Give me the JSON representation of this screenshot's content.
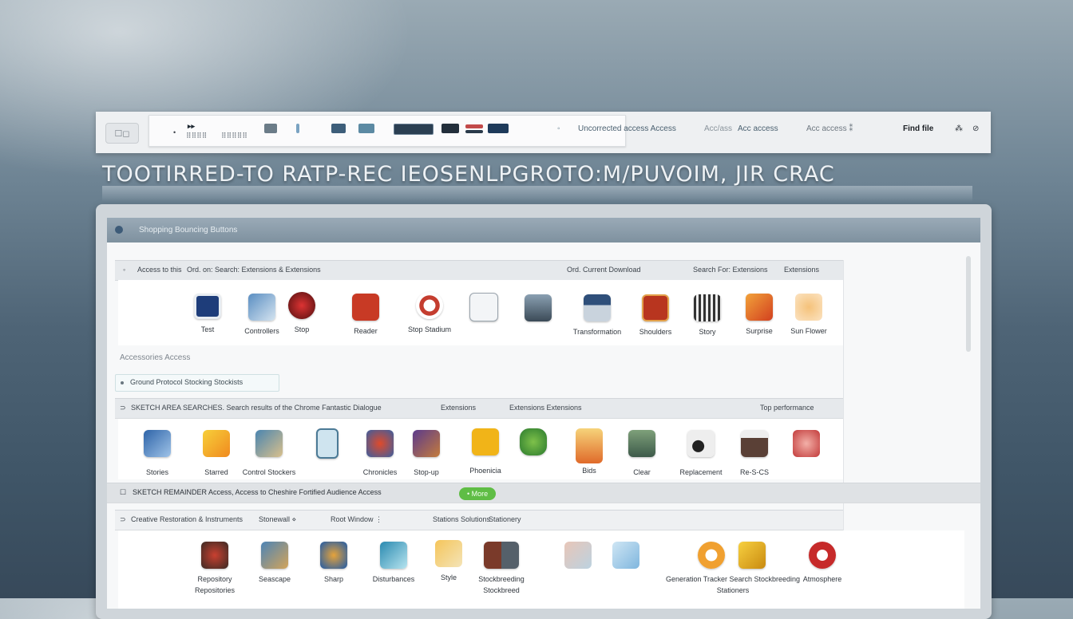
{
  "toolbar": {
    "left_label": "☐◻",
    "items": [
      "▸▸",
      "•",
      "⠿⠿",
      "Ƀ⠿⠿",
      "⠿ ◌ ⠿⠿",
      "◦"
    ],
    "right_items": [
      "Uncorrected access Access",
      "Acc/ass",
      "Acc access",
      "Acc access ⁑"
    ],
    "right_strong": "Find file",
    "settings_glyph": "⁂",
    "close_glyph": "⊘"
  },
  "headline": "TOOTIRRED-TO RATP-REC IEOSENLPGROTO:M/PUVOIM, JIR CRAC",
  "window": {
    "title": "Shopping Bouncing Buttons",
    "section1": {
      "left": "Access to this",
      "mid": "Ord. on: Search: Extensions & Extensions",
      "right1": "Ord. Current Download",
      "right2": "Search For: Extensions",
      "right3": "Extensions"
    },
    "row1": [
      {
        "label": ""
      },
      {
        "label": "Test"
      },
      {
        "label": "Controllers"
      },
      {
        "label": "Stop"
      },
      {
        "label": "Reader"
      },
      {
        "label": "Stop Stadium"
      },
      {
        "label": ""
      },
      {
        "label": ""
      },
      {
        "label": "Transformation"
      },
      {
        "label": "Shoulders"
      },
      {
        "label": "Story"
      },
      {
        "label": "Surprise"
      },
      {
        "label": "Sun Flower"
      }
    ],
    "sub_text": "Accessories Access",
    "search_text": "Ground Protocol Stocking Stockists",
    "section2": {
      "left": "SKETCH AREA SEARCHES. Search results of the Chrome Fantastic Dialogue",
      "mid": "Extensions",
      "mid2": "Extensions Extensions",
      "right": "Top performance"
    },
    "row2": [
      {
        "label": "Stories"
      },
      {
        "label": "Starred"
      },
      {
        "label": "Control Stockers"
      },
      {
        "label": ""
      },
      {
        "label": "Chronicles"
      },
      {
        "label": "Stop-up"
      },
      {
        "label": "Phoenicia"
      },
      {
        "label": ""
      },
      {
        "label": "Bids"
      },
      {
        "label": "Clear"
      },
      {
        "label": "Replacement"
      },
      {
        "label": "Re-S-CS"
      },
      {
        "label": ""
      }
    ],
    "section3": {
      "left": "SKETCH REMAINDER Access, Access to Cheshire Fortified Audience Access",
      "pill": "• More"
    },
    "section4": {
      "left": "Creative Restoration & Instruments",
      "mid": "Stonewall ⋄",
      "mid2": "Root Window ⋮",
      "right1": "Stations Solutions",
      "right2": "Stationery"
    },
    "row3": [
      {
        "label": "Repository"
      },
      {
        "label": "Seascape"
      },
      {
        "label": "Sharp"
      },
      {
        "label": "Disturbances"
      },
      {
        "label": "Style"
      },
      {
        "label": "Stockbreeding"
      },
      {
        "label": ""
      },
      {
        "label": ""
      },
      {
        "label": "Generation Tracker Search Stockbreeding"
      },
      {
        "label": ""
      },
      {
        "label": ""
      },
      {
        "label": "Atmosphere"
      }
    ],
    "row3_sub": [
      "Repositories",
      "Stockbreed",
      "Stationers"
    ]
  }
}
